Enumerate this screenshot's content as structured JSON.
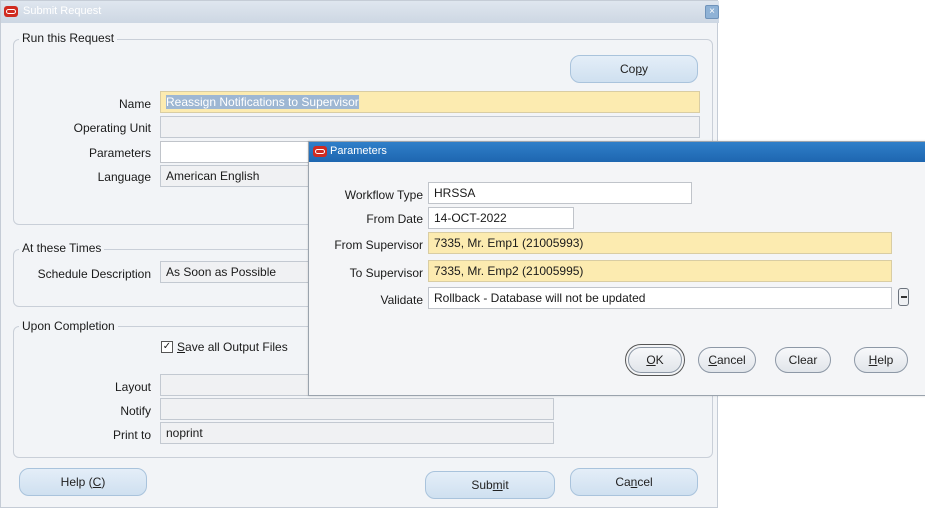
{
  "main": {
    "title": "Submit Request",
    "run_section": {
      "legend": "Run this Request",
      "copy_button": {
        "pre": "Co",
        "accel": "p",
        "post": "y"
      },
      "fields": {
        "name_label": "Name",
        "name_value": "Reassign Notifications to Supervisor",
        "operating_unit_label": "Operating Unit",
        "operating_unit_value": "",
        "parameters_label": "Parameters",
        "parameters_value": "",
        "language_label": "Language",
        "language_value": "American English"
      }
    },
    "times_section": {
      "legend": "At these Times",
      "schedule_label": "Schedule Description",
      "schedule_value": "As Soon as Possible"
    },
    "completion_section": {
      "legend": "Upon Completion",
      "save_outputs": {
        "checked": true,
        "accel": "S",
        "rest": "ave all Output Files"
      },
      "layout_label": "Layout",
      "layout_value": "",
      "notify_label": "Notify",
      "notify_value": "",
      "print_to_label": "Print to",
      "print_to_value": "noprint"
    },
    "buttons": {
      "help": {
        "pre": "Help (",
        "accel": "C",
        "post": ")"
      },
      "submit": {
        "pre": "Sub",
        "accel": "m",
        "post": "it"
      },
      "cancel": {
        "pre": "Ca",
        "accel": "n",
        "post": "cel"
      }
    }
  },
  "param_dialog": {
    "title": "Parameters",
    "workflow_type_label": "Workflow Type",
    "workflow_type_value": "HRSSA",
    "from_date_label": "From Date",
    "from_date_value": "14-OCT-2022",
    "from_supervisor_label": "From Supervisor",
    "from_supervisor_value": "7335, Mr. Emp1 (21005993)",
    "to_supervisor_label": "To Supervisor",
    "to_supervisor_value": "7335, Mr. Emp2 (21005995)",
    "validate_label": "Validate",
    "validate_value": "Rollback - Database will not be updated",
    "buttons": {
      "ok": {
        "accel": "O",
        "rest": "K"
      },
      "cancel": {
        "accel": "C",
        "rest": "ancel"
      },
      "clear": {
        "label": "Clear"
      },
      "help": {
        "accel": "H",
        "rest": "elp"
      }
    }
  },
  "colors": {
    "required_field": "#fcebb0",
    "dialog_titlebar": "#1e66b0",
    "oracle_red": "#d02b20"
  },
  "icons": [
    "oracle-logo-icon",
    "close-icon",
    "list-of-values-icon",
    "checkbox-checked-icon"
  ]
}
